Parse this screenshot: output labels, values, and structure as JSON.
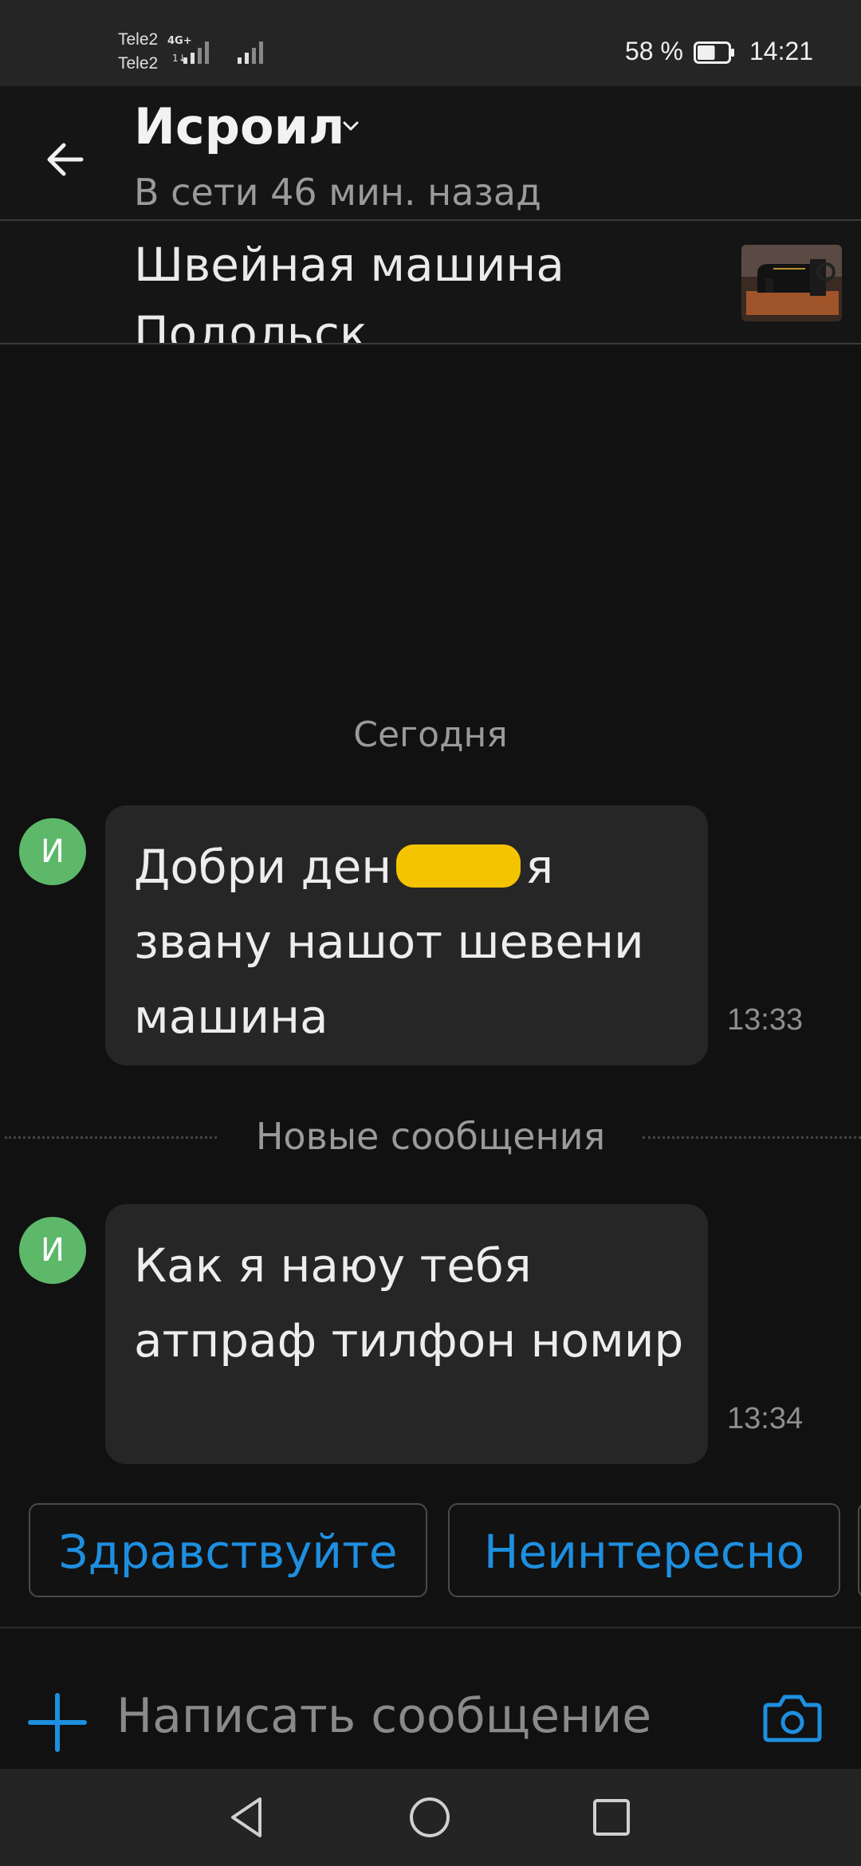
{
  "status_bar": {
    "carrier_1": "Tele2",
    "carrier_2": "Tele2",
    "network_type": "4G+",
    "network_sub": "1↓",
    "battery_percent": "58 %",
    "battery_level": 0.58,
    "time": "14:21",
    "icons": [
      "signal-bars-icon",
      "signal-bars-icon",
      "battery-icon"
    ]
  },
  "header": {
    "contact_name": "Исроил",
    "presence": "В сети 46 мин. назад",
    "icons": [
      "back-arrow-icon",
      "chevron-down-icon"
    ]
  },
  "listing": {
    "title": "Швейная машина Подольск",
    "thumbnail": "sewing-machine-photo"
  },
  "chat": {
    "date_separator": "Сегодня",
    "new_messages_label": "Новые сообщения",
    "messages": [
      {
        "avatar_letter": "И",
        "text_before": "Добри ден",
        "text_after": "я звану нашот шевени машина",
        "redacted": true,
        "time": "13:33"
      },
      {
        "avatar_letter": "И",
        "text": "Как я наюу тебя атпраф тилфон номир",
        "time": "13:34"
      }
    ],
    "colors": {
      "avatar": "#5db86a",
      "bubble": "#262626",
      "censor": "#f5c400"
    }
  },
  "quick_replies": [
    "Здравствуйте",
    "Неинтересно"
  ],
  "composer": {
    "placeholder": "Написать сообщение",
    "icons": [
      "plus-icon",
      "camera-icon"
    ],
    "accent": "#1e8fe0"
  },
  "nav_bar": {
    "icons": [
      "nav-back-icon",
      "nav-home-icon",
      "nav-recents-icon"
    ]
  }
}
